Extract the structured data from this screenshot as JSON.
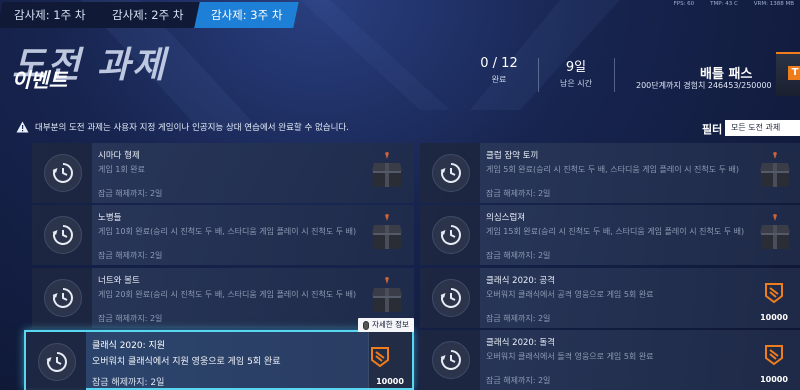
{
  "tabs": [
    {
      "label": "감사제: 1주 차",
      "active": false
    },
    {
      "label": "감사제: 2주 차",
      "active": false
    },
    {
      "label": "감사제: 3주 차",
      "active": true
    }
  ],
  "perf": {
    "fps": "FPS: 60",
    "temp": "TMP: 43 C",
    "vram": "VRM: 1388 MB"
  },
  "header": {
    "title_main": "도전 과제",
    "title_sub": "이벤트",
    "completed_value": "0 / 12",
    "completed_label": "완료",
    "remaining_value": "9일",
    "remaining_label": "남은 시간",
    "battlepass_title": "배틀 패스",
    "battlepass_sub": "200단계까지 경험치 246453/250000",
    "battlepass_badge": "T"
  },
  "warning": {
    "text": "대부분의 도전 과제는 사용자 지정 게임이나 인공지능 상대 연습에서 완료할 수 없습니다."
  },
  "filter": {
    "label": "필터",
    "value": "모든 도전 과제"
  },
  "challenges": [
    {
      "title": "시마다 형제",
      "desc": "게임 1회 완료",
      "unlock": "잠금 해제까지: 2일",
      "reward": "loot-box",
      "reward_value": ""
    },
    {
      "title": "클럽 잠약 토끼",
      "desc": "게임 5회 완료(승리 시 진척도 두 배, 스타디움 게임 플레이 시 진척도 두 배)",
      "unlock": "잠금 해제까지: 2일",
      "reward": "loot-box",
      "reward_value": ""
    },
    {
      "title": "노병들",
      "desc": "게임 10회 완료(승리 시 진척도 두 배, 스타디움 게임 플레이 시 진척도 두 배)",
      "unlock": "잠금 해제까지: 2일",
      "reward": "loot-box",
      "reward_value": ""
    },
    {
      "title": "의심스럽져",
      "desc": "게임 15회 완료(승리 시 진척도 두 배, 스타디움 게임 플레이 시 진척도 두 배)",
      "unlock": "잠금 해제까지: 2일",
      "reward": "loot-box",
      "reward_value": ""
    },
    {
      "title": "너트와 볼트",
      "desc": "게임 20회 완료(승리 시 진척도 두 배, 스타디움 게임 플레이 시 진척도 두 배)",
      "unlock": "잠금 해제까지: 2일",
      "reward": "loot-box",
      "reward_value": ""
    },
    {
      "title": "클래식 2020: 공격",
      "desc": "오버워치 클래식에서 공격 영웅으로 게임 5회 완료",
      "unlock": "잠금 해제까지: 2일",
      "reward": "token",
      "reward_value": "10000"
    },
    {
      "title": "클래식 2020: 지원",
      "desc": "오버워치 클래식에서 지원 영웅으로 게임 5회 완료",
      "unlock": "잠금 해제까지: 2일",
      "reward": "token",
      "reward_value": "10000"
    },
    {
      "title": "클래식 2020: 돌격",
      "desc": "오버워치 클래식에서 돌격 영웅으로 게임 5회 완료",
      "unlock": "잠금 해제까지: 2일",
      "reward": "token",
      "reward_value": "10000"
    }
  ],
  "tooltip": {
    "label": "자세한 정보"
  },
  "colors": {
    "accent": "#1e7fd6",
    "selected_border": "#59d7f0",
    "token_orange": "#f07d1c"
  }
}
